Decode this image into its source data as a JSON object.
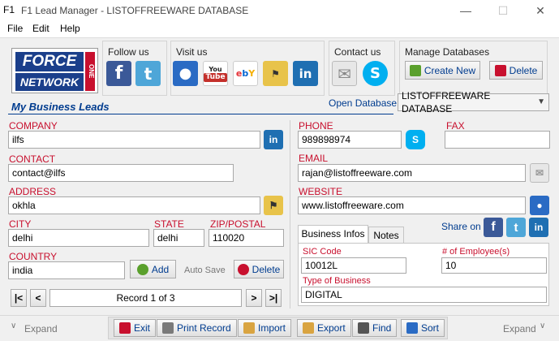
{
  "window": {
    "title": "F1 Lead Manager - LISTOFFREEWARE DATABASE",
    "app_icon_text": "F1",
    "minimize": "—",
    "maximize": "☐",
    "close": "✕"
  },
  "menu": {
    "file": "File",
    "edit": "Edit",
    "help": "Help"
  },
  "logo": {
    "force": "FORCE",
    "one": "ONE",
    "network": "NETWORK"
  },
  "toolbar": {
    "follow_us": "Follow us",
    "visit_us": "Visit us",
    "contact_us": "Contact us",
    "manage_databases": "Manage Databases",
    "create_new": "Create New",
    "delete": "Delete",
    "youtube_text": "You Tube",
    "ebay_text": "ebY"
  },
  "section": {
    "title": "My Business Leads",
    "open_database_label": "Open Database",
    "database_selected": "LISTOFFREEWARE DATABASE"
  },
  "form": {
    "company_label": "COMPANY",
    "company": "ilfs",
    "contact_label": "CONTACT",
    "contact": "contact@ilfs",
    "address_label": "ADDRESS",
    "address": "okhla",
    "city_label": "CITY",
    "city": "delhi",
    "state_label": "STATE",
    "state": "delhi",
    "zip_label": "ZIP/POSTAL",
    "zip": "110020",
    "country_label": "COUNTRY",
    "country": "india",
    "add_label": "Add",
    "auto_save": "Auto Save",
    "delete_label": "Delete",
    "phone_label": "PHONE",
    "phone": "989898974",
    "fax_label": "FAX",
    "fax": "",
    "email_label": "EMAIL",
    "email": "rajan@listoffreeware.com",
    "website_label": "WEBSITE",
    "website": "www.listoffreeware.com",
    "share_on": "Share on"
  },
  "navigator": {
    "first": "|<",
    "prev": "<",
    "record": "Record 1 of 3",
    "next": ">",
    "last": ">|"
  },
  "tabs": {
    "business_infos": "Business Infos",
    "notes": "Notes",
    "sic_code_label": "SIC Code",
    "sic_code": "10012L",
    "employees_label": "# of Employee(s)",
    "employees": "10",
    "type_label": "Type of Business",
    "type": "DIGITAL"
  },
  "bottom": {
    "expand_left": "Expand",
    "expand_right": "Expand",
    "exit": "Exit",
    "print_record": "Print Record",
    "import": "Import",
    "export": "Export",
    "find": "Find",
    "sort": "Sort"
  },
  "colors": {
    "label_red": "#c8102e",
    "link_blue": "#003c8f",
    "facebook": "#3b5998",
    "twitter": "#4ea6d8",
    "linkedin": "#1f6fb2",
    "skype": "#00aff0"
  }
}
